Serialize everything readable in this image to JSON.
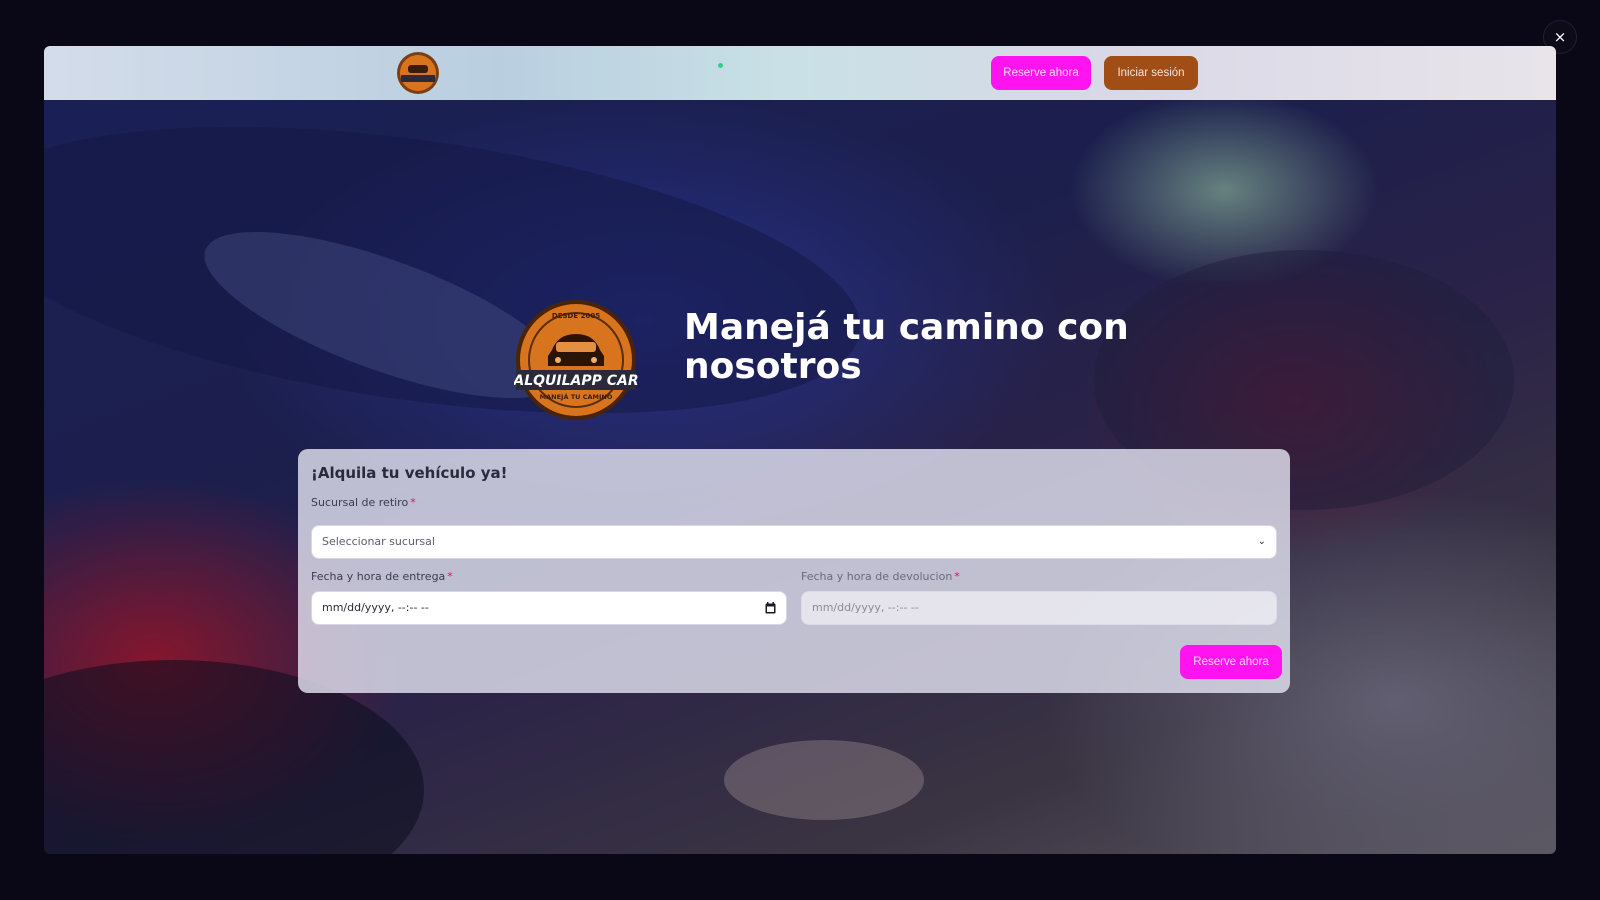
{
  "modal": {
    "close_label": "×"
  },
  "header": {
    "logo_text": "ALQUILAPP CAR",
    "reserve_label": "Reserve ahora",
    "login_label": "Iniciar sesión"
  },
  "hero": {
    "logo": {
      "since": "DESDE 2005",
      "brand": "ALQUILAPP CAR",
      "tagline": "MANEJÁ TU CAMINO"
    },
    "title_line1": "Manejá tu camino con",
    "title_line2": "nosotros"
  },
  "form": {
    "title": "¡Alquila tu vehículo ya!",
    "branch_label": "Sucursal de retiro",
    "branch_placeholder": "Seleccionar sucursal",
    "pickup_label": "Fecha y hora de entrega",
    "pickup_value": "mm/dd/yyyy, --:-- --",
    "return_label": "Fecha y hora de devolucion",
    "return_value": "mm/dd/yyyy, --:-- --",
    "required_mark": "*",
    "submit_label": "Reserve ahora"
  },
  "colors": {
    "accent_magenta": "#ff14f0",
    "login_brown": "#a04e16",
    "required_red": "#e0125a",
    "logo_orange": "#d9741e"
  },
  "icons": [
    "close-icon",
    "chevron-down-icon",
    "calendar-icon"
  ]
}
